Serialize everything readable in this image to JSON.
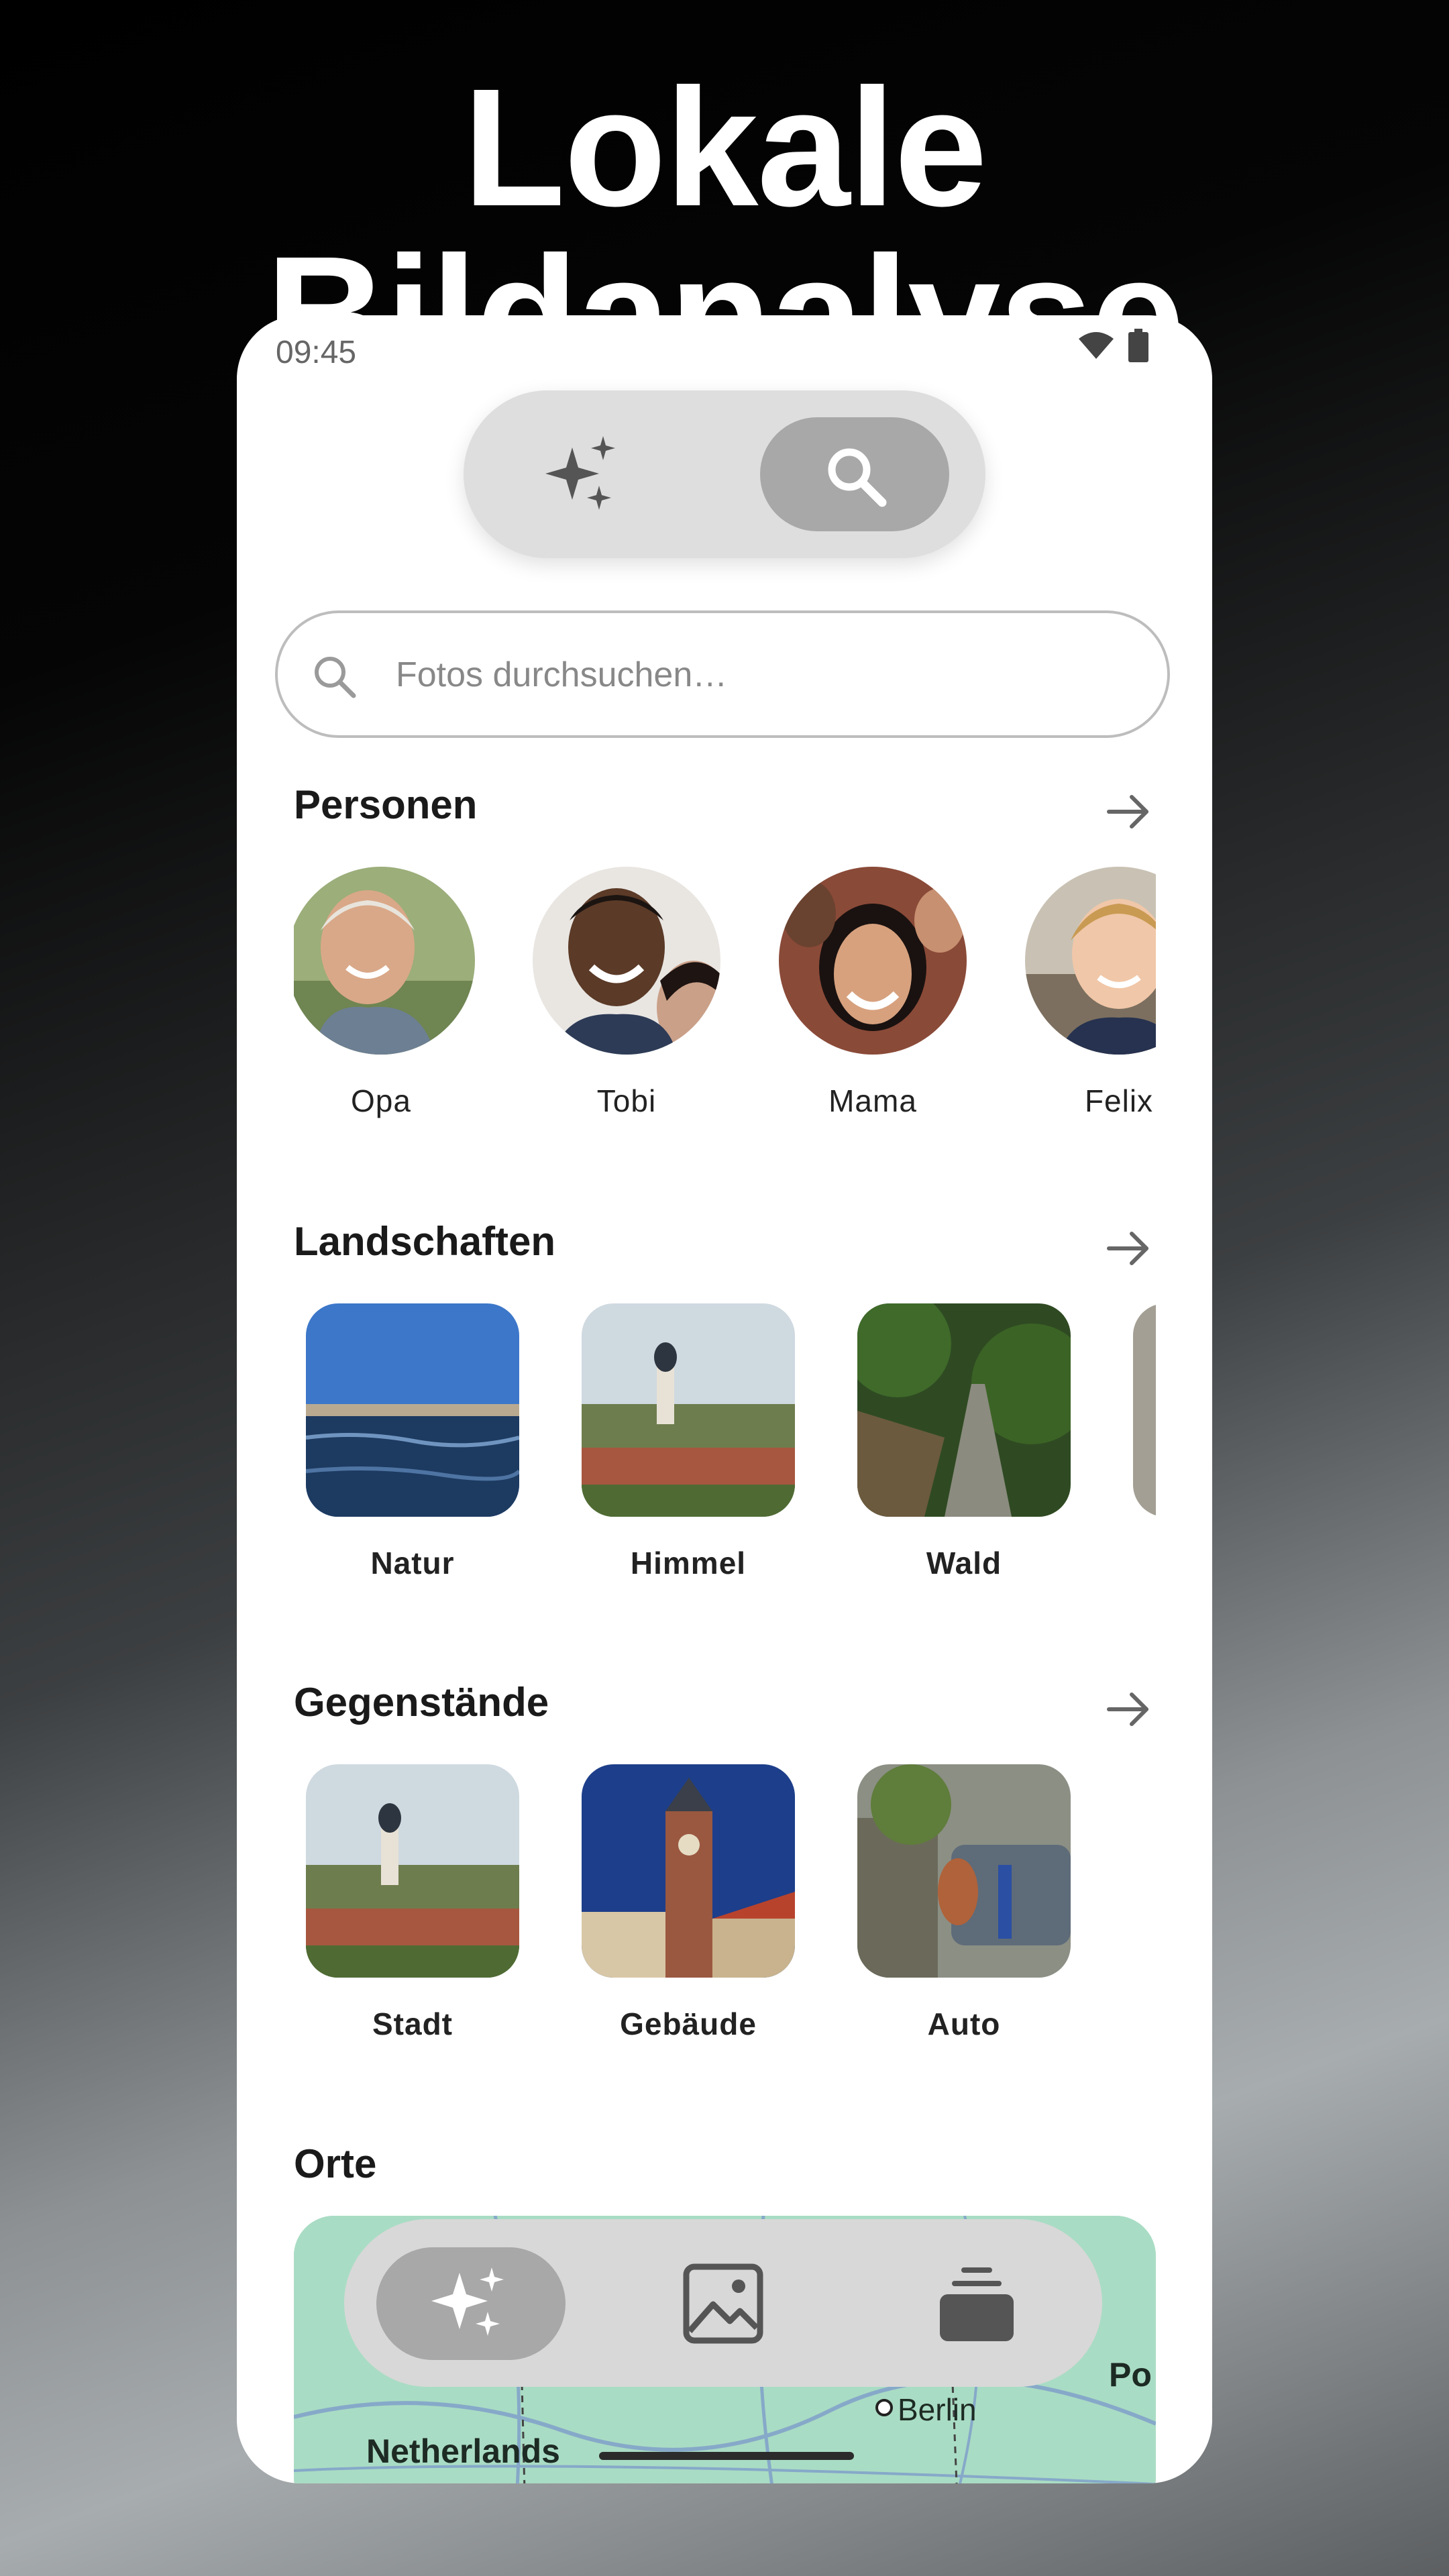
{
  "headline": "Lokale Bildanalyse",
  "status_bar": {
    "time": "09:45",
    "icons": [
      "wifi-icon",
      "battery-icon"
    ]
  },
  "mode_toggle": {
    "left_icon": "sparkles-icon",
    "right_icon": "search-icon",
    "selected": "search"
  },
  "search": {
    "placeholder": "Fotos durchsuchen…",
    "value": ""
  },
  "sections": {
    "people": {
      "title": "Personen",
      "items": [
        {
          "label": "Opa"
        },
        {
          "label": "Tobi"
        },
        {
          "label": "Mama"
        },
        {
          "label": "Felix"
        }
      ]
    },
    "landscapes": {
      "title": "Landschaften",
      "items": [
        {
          "label": "Natur"
        },
        {
          "label": "Himmel"
        },
        {
          "label": "Wald"
        }
      ]
    },
    "objects": {
      "title": "Gegenstände",
      "items": [
        {
          "label": "Stadt"
        },
        {
          "label": "Gebäude"
        },
        {
          "label": "Auto"
        }
      ]
    },
    "places": {
      "title": "Orte",
      "map_labels": {
        "country": "Netherlands",
        "city": "Berlin",
        "edge": "Po"
      }
    }
  },
  "bottom_nav": {
    "items": [
      "sparkles-icon",
      "gallery-icon",
      "stack-icon"
    ],
    "active": "sparkles-icon"
  },
  "colors": {
    "toggle_bg": "#dedede",
    "toggle_active": "#a8a8a8",
    "map_bg": "#a9dcc4"
  }
}
